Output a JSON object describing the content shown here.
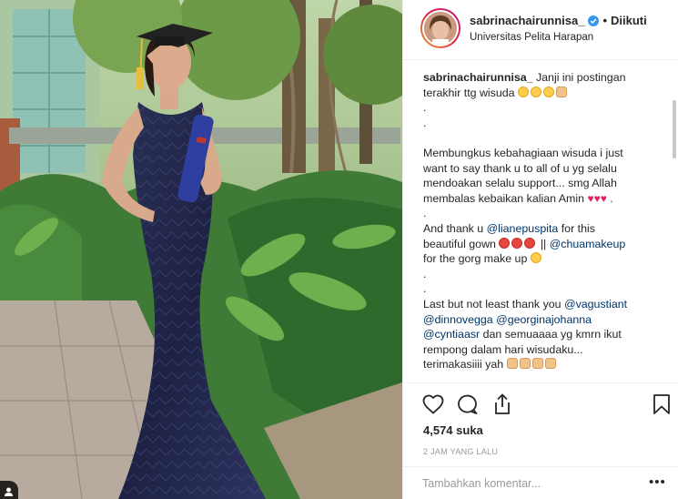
{
  "post": {
    "username": "sabrinachairunnisa_",
    "follow_status": "Diikuti",
    "location": "Universitas Pelita Harapan",
    "likes": "4,574 suka",
    "time_ago": "2 JAM YANG LALU"
  },
  "caption": {
    "l1_text": "Janji ini postingan",
    "l2_text": "terakhir ttg wisuda",
    "dot": ".",
    "l3": "Membungkus kebahagiaan wisuda i just",
    "l4": "want to say thank u to all of u yg selalu",
    "l5": "mendoakan selalu support... smg Allah",
    "l6": "membalas kebaikan kalian Amin",
    "l7_pre": "And thank u ",
    "m_liane": "@lianepuspita",
    "l7_post": " for this",
    "l8_pre": "beautiful gown",
    "l8_mid": " || ",
    "m_chua": "@chuamakeup",
    "l9": "for the gorg make up",
    "l10_pre": "Last but not least thank you ",
    "m_vagus": "@vagustiant",
    "m_dinno": "@dinnovegga",
    "m_georg": "@georginajohanna",
    "m_cynt": "@cyntiaasr",
    "l12_post": " dan semuaaaa yg kmrn ikut",
    "l13": "rempong dalam hari wisudaku...",
    "l14": "terimakasiiii yah",
    "heart": "♥"
  },
  "comment": {
    "placeholder": "Tambahkan komentar..."
  },
  "icons": {
    "like": "heart-outline-icon",
    "comment": "speech-bubble-icon",
    "share": "share-upload-icon",
    "save": "bookmark-icon",
    "verified": "verified-badge-icon",
    "more": "ellipsis-icon",
    "user_tag": "user-tag-icon"
  },
  "colors": {
    "text": "#262626",
    "mention": "#003569",
    "muted": "#999999",
    "verified": "#3897f0",
    "border": "#efefef",
    "heart": "#e0245e"
  }
}
